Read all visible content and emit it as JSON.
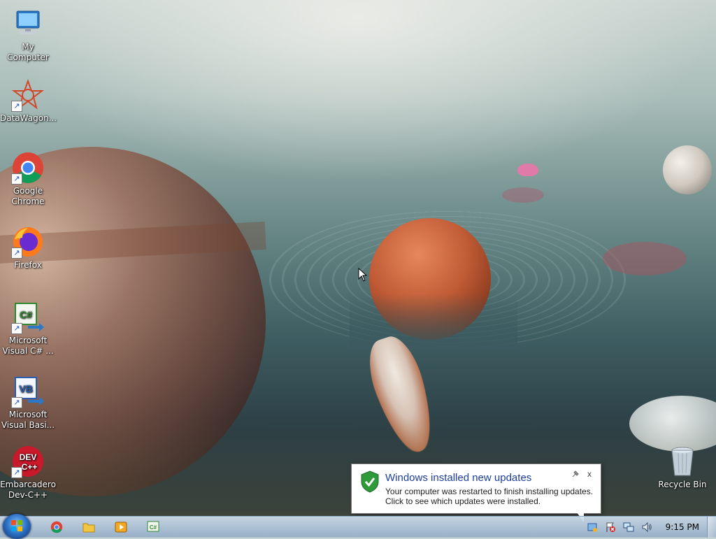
{
  "desktop": {
    "icons": [
      {
        "label": "My Computer"
      },
      {
        "label": "DataWagon..."
      },
      {
        "label": "Google Chrome"
      },
      {
        "label": "Firefox"
      },
      {
        "label": "Microsoft Visual C# ..."
      },
      {
        "label": "Microsoft Visual Basi..."
      },
      {
        "label": "Embarcadero Dev-C++"
      },
      {
        "label": "Recycle Bin"
      }
    ]
  },
  "notification": {
    "title": "Windows installed new updates",
    "body_line1": "Your computer was restarted to finish installing updates.",
    "body_line2": "Click to see which updates were installed.",
    "close_glyph": "x"
  },
  "taskbar": {
    "pinned": [
      {
        "icon": "chrome-icon"
      },
      {
        "icon": "folder-icon"
      },
      {
        "icon": "media-player-icon"
      },
      {
        "icon": "visual-csharp-icon"
      }
    ],
    "clock": "9:15 PM"
  },
  "colors": {
    "taskbar_top": "#d2e1f0",
    "notification_title": "#1c3e9a"
  }
}
